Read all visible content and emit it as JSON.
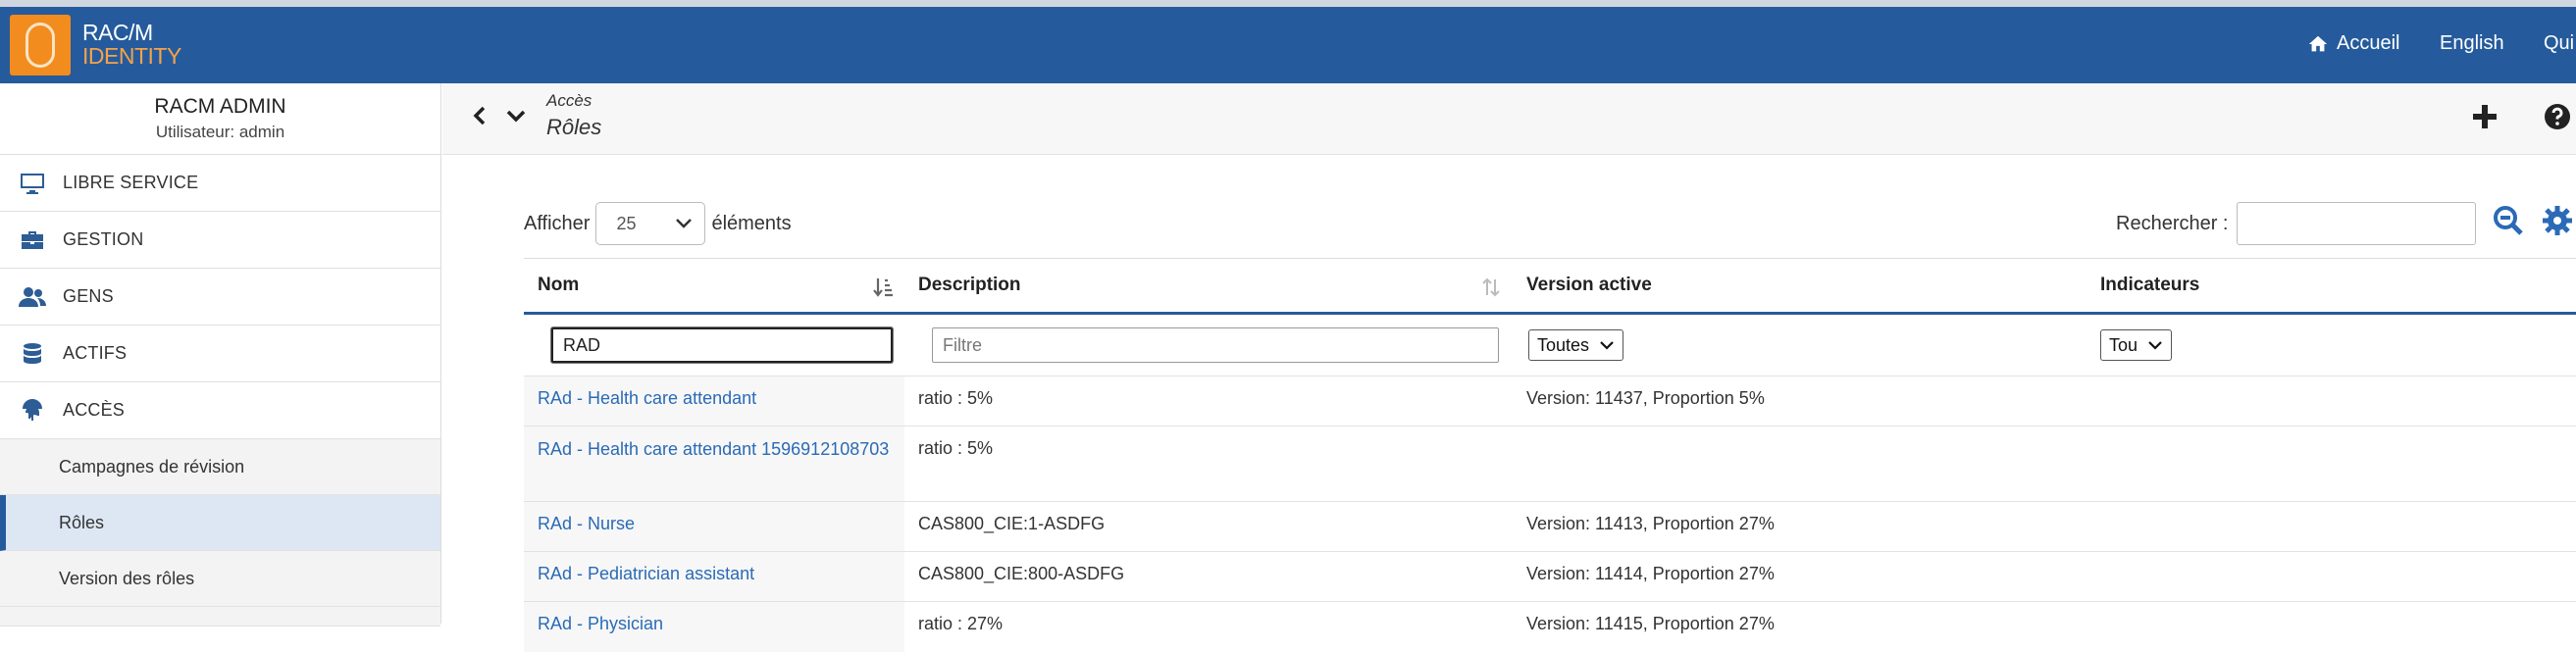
{
  "brand": {
    "line1": "RAC/M",
    "line2": "IDENTITY",
    "logo_color": "#f28c1e",
    "bar_color": "#255b9c"
  },
  "topnav": {
    "home": "Accueil",
    "language": "English",
    "quit": "Qui"
  },
  "user": {
    "name": "RACM ADMIN",
    "subtitle": "Utilisateur: admin"
  },
  "sidebar": {
    "items": [
      {
        "label": "LIBRE SERVICE",
        "icon": "monitor-icon"
      },
      {
        "label": "GESTION",
        "icon": "toolbox-icon"
      },
      {
        "label": "GENS",
        "icon": "users-icon"
      },
      {
        "label": "ACTIFS",
        "icon": "database-icon"
      },
      {
        "label": "ACCÈS",
        "icon": "fingerprint-icon"
      }
    ],
    "subitems": [
      {
        "label": "Campagnes de révision",
        "active": false
      },
      {
        "label": "Rôles",
        "active": true
      },
      {
        "label": "Version des rôles",
        "active": false
      }
    ]
  },
  "header": {
    "breadcrumb": "Accès",
    "title": "Rôles"
  },
  "controls": {
    "show_label": "Afficher",
    "page_size": "25",
    "elements_label": "éléments",
    "search_label": "Rechercher :",
    "search_value": ""
  },
  "table": {
    "columns": [
      "Nom",
      "Description",
      "Version active",
      "Indicateurs"
    ],
    "filters": {
      "name_value": "RAD",
      "description_placeholder": "Filtre",
      "version_select": "Toutes",
      "indicator_select": "Tou"
    },
    "rows": [
      {
        "name": "RAd - Health care attendant",
        "description": "ratio : 5%",
        "version": "Version: 11437, Proportion 5%"
      },
      {
        "name": "RAd - Health care attendant 1596912108703",
        "description": "ratio : 5%",
        "version": ""
      },
      {
        "name": "RAd - Nurse",
        "description": "CAS800_CIE:1-ASDFG",
        "version": "Version: 11413, Proportion 27%"
      },
      {
        "name": "RAd - Pediatrician assistant",
        "description": "CAS800_CIE:800-ASDFG",
        "version": "Version: 11414, Proportion 27%"
      },
      {
        "name": "RAd - Physician",
        "description": "ratio : 27%",
        "version": "Version: 11415, Proportion 27%"
      }
    ]
  }
}
